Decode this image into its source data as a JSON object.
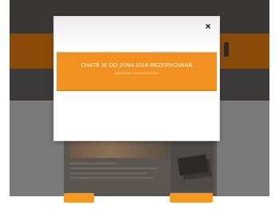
{
  "modal": {
    "close_label": "×",
    "banner_title": "CHATA JE DO JÚNA 2014 REZERVOVANÁ",
    "banner_subtitle": "ĎAKUJEME ZA POCHOPENIE"
  },
  "colors": {
    "accent": "#f2911f",
    "overlay": "#3a3634",
    "modal_background": "#ffffff"
  }
}
